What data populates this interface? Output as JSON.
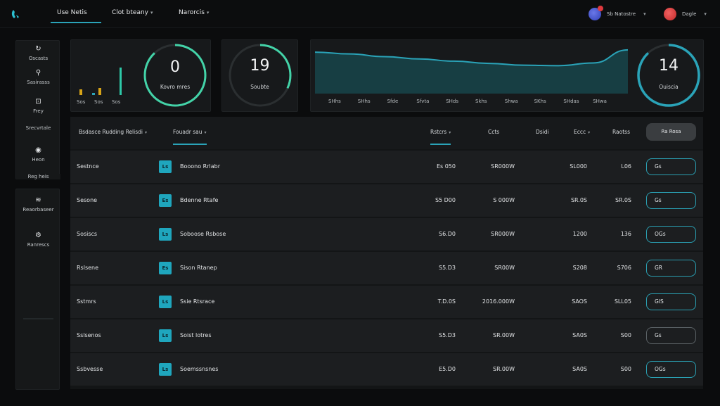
{
  "app": {
    "logo_icon": "phone-icon",
    "accent": "#2aa3b8"
  },
  "topnav": {
    "tabs": [
      {
        "label": "Use Netis",
        "active": true
      },
      {
        "label": "Clot bteany",
        "dropdown": true
      },
      {
        "label": "Narorcis",
        "dropdown": true
      }
    ],
    "users": [
      {
        "name": "Sb Natostre",
        "avatar": "user-avatar"
      },
      {
        "name": "Dagle",
        "avatar": "user-avatar"
      }
    ]
  },
  "sidebar": {
    "items": [
      {
        "icon": "refresh-icon",
        "label": "Oscasts"
      },
      {
        "icon": "pin-icon",
        "label": "Sasirasss"
      },
      {
        "icon": "tag-icon",
        "label": "Frey"
      },
      {
        "label": "Srecvrtale"
      },
      {
        "icon": "ring-icon",
        "label": "Heon"
      },
      {
        "label": "Reg heis"
      }
    ],
    "items2": [
      {
        "icon": "stack-icon",
        "label": "Reaorbaseer"
      },
      {
        "icon": "settings-icon",
        "label": "Ranrescs"
      }
    ]
  },
  "metrics": {
    "mini_bar": {
      "labels": [
        "Sos",
        "Sos",
        "Sos"
      ],
      "values": [
        0.18,
        0.22,
        0.85
      ]
    },
    "ring1": {
      "value": "0",
      "label": "Kovro mres",
      "progress": 0.88
    },
    "ring2": {
      "value": "19",
      "label": "Soubte",
      "progress": 0.32
    },
    "ring3": {
      "value": "14",
      "label": "Ouiscia",
      "progress": 0.88
    }
  },
  "chart_data": {
    "type": "area",
    "categories": [
      "SHhs",
      "SHhs",
      "Sfde",
      "Sfvta",
      "SHds",
      "Skhs",
      "Shwa",
      "SKhs",
      "SHdas",
      "SHwa"
    ],
    "values": [
      0.92,
      0.88,
      0.82,
      0.77,
      0.72,
      0.67,
      0.63,
      0.62,
      0.68,
      0.97
    ],
    "grid": false,
    "legend": "none",
    "color": "#2aa3b8"
  },
  "table": {
    "headers": {
      "col1": "Bsdasce Rudding Relisdi",
      "col2": "Fouadr sau",
      "col3": "Rstcrs",
      "col4": "Ccts",
      "col5": "Dsidi",
      "col6": "Eccc",
      "col7": "Raotss"
    },
    "action_label": "Ra Rosa",
    "rows": [
      {
        "name": "Sestnce",
        "icon": "Ls",
        "detail": "Booono Rrlabr",
        "c1": "Es 050",
        "c2": "SR000W",
        "c3": "SL000",
        "c4": "L06",
        "btn": "Gs"
      },
      {
        "name": "Sesone",
        "icon": "Es",
        "detail": "Bdenne Rtafe",
        "c1": "S5 D00",
        "c2": "S 000W",
        "c3": "SR.0S",
        "c4": "SR.0S",
        "btn": "Gs"
      },
      {
        "name": "Sosiscs",
        "icon": "Ls",
        "detail": "Soboose Rsbose",
        "c1": "S6.D0",
        "c2": "SR000W",
        "c3": "1200",
        "c4": "136",
        "btn": "OGs"
      },
      {
        "name": "Rslsene",
        "icon": "Es",
        "detail": "Sison Rtanep",
        "c1": "S5.D3",
        "c2": "SR00W",
        "c3": "S208",
        "c4": "S706",
        "btn": "GR"
      },
      {
        "name": "Sstmrs",
        "icon": "Ls",
        "detail": "Ssie Rtsrace",
        "c1": "T.D.0S",
        "c2": "2016.000W",
        "c3": "SAOS",
        "c4": "SLL05",
        "btn": "GIS"
      },
      {
        "name": "Sslsenos",
        "icon": "Ls",
        "detail": "Soist lotres",
        "c1": "S5.D3",
        "c2": "SR.00W",
        "c3": "SA0S",
        "c4": "S00",
        "btn": "Gs"
      },
      {
        "name": "Ssbvesse",
        "icon": "Ls",
        "detail": "Soemssnsnes",
        "c1": "E5.D0",
        "c2": "SR.00W",
        "c3": "SA0S",
        "c4": "S00",
        "btn": "OGs"
      }
    ]
  }
}
